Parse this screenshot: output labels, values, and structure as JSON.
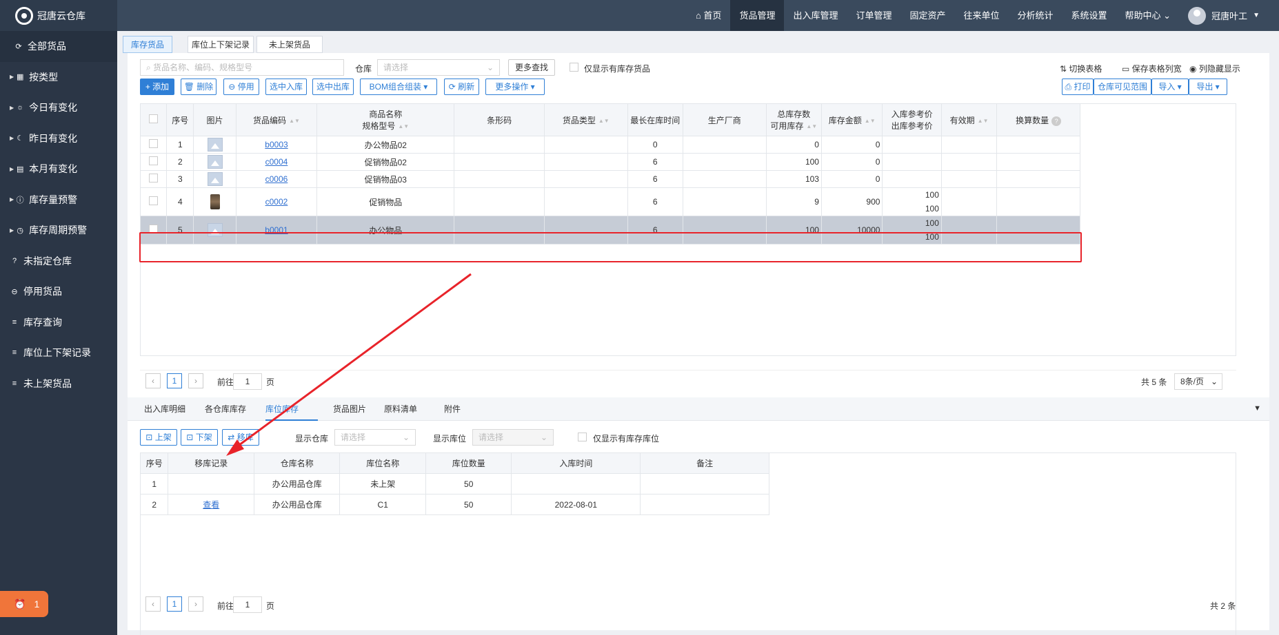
{
  "app": {
    "name": "冠唐云仓库"
  },
  "topnav": {
    "items": [
      "首页",
      "货品管理",
      "出入库管理",
      "订单管理",
      "固定资产",
      "往来单位",
      "分析统计",
      "系统设置",
      "帮助中心"
    ],
    "user": "冠唐叶工"
  },
  "sidebar": {
    "items": [
      {
        "label": "全部货品",
        "icon": "refresh-icon"
      },
      {
        "label": "按类型",
        "icon": "grid-icon"
      },
      {
        "label": "今日有变化",
        "icon": "sun-icon"
      },
      {
        "label": "昨日有变化",
        "icon": "moon-icon"
      },
      {
        "label": "本月有变化",
        "icon": "calendar-icon"
      },
      {
        "label": "库存量预警",
        "icon": "alert-icon"
      },
      {
        "label": "库存周期预警",
        "icon": "clock-icon"
      },
      {
        "label": "未指定仓库",
        "icon": "question-icon"
      },
      {
        "label": "停用货品",
        "icon": "minus-circle-icon"
      },
      {
        "label": "库存查询",
        "icon": "list-icon"
      },
      {
        "label": "库位上下架记录",
        "icon": "list-icon"
      },
      {
        "label": "未上架货品",
        "icon": "list-icon"
      }
    ],
    "badge": "1"
  },
  "page_tabs": [
    "库存货品",
    "库位上下架记录",
    "未上架货品"
  ],
  "filters": {
    "search_placeholder": "货品名称、编码、规格型号",
    "warehouse_label": "仓库",
    "warehouse_placeholder": "请选择",
    "more_search": "更多查找",
    "only_stock": "仅显示有库存货品"
  },
  "tools": {
    "switch_table": "切换表格",
    "save_widths": "保存表格列宽",
    "hide_cols": "列隐藏显示"
  },
  "toolbar": {
    "add": "+ 添加",
    "delete": "删除",
    "disable": "停用",
    "in": "选中入库",
    "out": "选中出库",
    "bom": "BOM组合组装 ▾",
    "refresh": "刷新",
    "more": "更多操作 ▾",
    "print": "打印",
    "visible": "仓库可见范围",
    "import": "导入 ▾",
    "export": "导出 ▾"
  },
  "table": {
    "headers": [
      "序号",
      "图片",
      "货品编码",
      "商品名称",
      "规格型号",
      "条形码",
      "货品类型",
      "最长在库时间",
      "生产厂商",
      "总库存数",
      "可用库存",
      "库存金额",
      "入库参考价",
      "出库参考价",
      "有效期",
      "换算数量"
    ],
    "rows": [
      {
        "no": "1",
        "code": "b0003",
        "name": "办公物品02",
        "days": "0",
        "stock": "0",
        "amount": "0",
        "pin": "",
        "pout": "",
        "img": "placeholder"
      },
      {
        "no": "2",
        "code": "c0004",
        "name": "促销物品02",
        "days": "6",
        "stock": "100",
        "amount": "0",
        "pin": "",
        "pout": "",
        "img": "placeholder"
      },
      {
        "no": "3",
        "code": "c0006",
        "name": "促销物品03",
        "days": "6",
        "stock": "103",
        "amount": "0",
        "pin": "",
        "pout": "",
        "img": "placeholder"
      },
      {
        "no": "4",
        "code": "c0002",
        "name": "促销物品",
        "days": "6",
        "stock": "9",
        "amount": "900",
        "pin": "100",
        "pout": "100",
        "img": "photo"
      },
      {
        "no": "5",
        "code": "b0001",
        "name": "办公物品",
        "days": "6",
        "stock": "100",
        "amount": "10000",
        "pin": "100",
        "pout": "100",
        "img": "placeholder"
      }
    ]
  },
  "pager1": {
    "goto": "前往",
    "page": "1",
    "unit": "页",
    "total": "共 5 条",
    "per": "8条/页"
  },
  "bottom_tabs": [
    "出入库明细",
    "各仓库库存",
    "库位库存",
    "货品图片",
    "原料清单",
    "附件"
  ],
  "bottom_toolbar": {
    "shelve": "上架",
    "unshelve": "下架",
    "move": "移库",
    "wh_label": "显示仓库",
    "wh_ph": "请选择",
    "loc_label": "显示库位",
    "loc_ph": "请选择",
    "only": "仅显示有库存库位"
  },
  "loc_table": {
    "headers": [
      "序号",
      "移库记录",
      "仓库名称",
      "库位名称",
      "库位数量",
      "入库时间",
      "备注"
    ],
    "rows": [
      {
        "no": "1",
        "rec": "",
        "wh": "办公用品仓库",
        "loc": "未上架",
        "qty": "50",
        "date": "",
        "note": ""
      },
      {
        "no": "2",
        "rec": "查看",
        "wh": "办公用品仓库",
        "loc": "C1",
        "qty": "50",
        "date": "2022-08-01",
        "note": ""
      }
    ]
  },
  "pager2": {
    "goto": "前往",
    "page": "1",
    "unit": "页",
    "total": "共 2 条"
  },
  "colors": {
    "header_bg": "#3a4a5d",
    "sidebar_bg": "#2b3646",
    "accent": "#2f7fd6",
    "highlight": "#e8232a"
  }
}
